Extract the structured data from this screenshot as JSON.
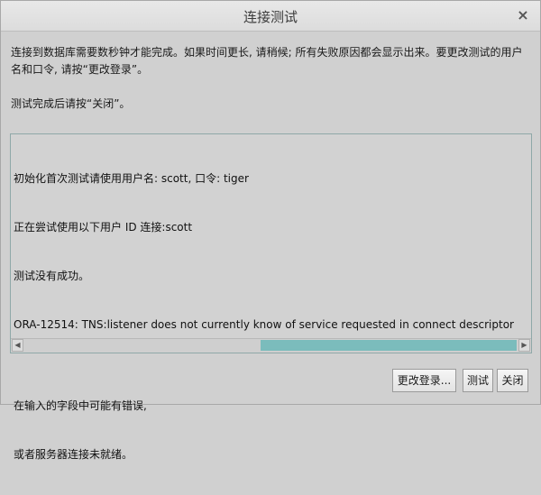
{
  "window": {
    "title": "连接测试",
    "close_glyph": "×"
  },
  "info": {
    "line1": "连接到数据库需要数秒钟才能完成。如果时间更长, 请稍候; 所有失败原因都会显示出来。要更改测试的用户",
    "line2": "名和口令, 请按“更改登录”。",
    "line3": "测试完成后请按“关闭”。"
  },
  "log": {
    "lines": [
      "初始化首次测试请使用用户名: scott, 口令: tiger",
      "正在尝试使用以下用户 ID 连接:scott",
      "测试没有成功。",
      "ORA-12514: TNS:listener does not currently know of service requested in connect descriptor",
      "",
      "在输入的字段中可能有错误,",
      "或者服务器连接未就绪。"
    ]
  },
  "scrollbar": {
    "left_arrow": "◀",
    "right_arrow": "▶"
  },
  "buttons": {
    "change_login": "更改登录...",
    "test": "测试",
    "close": "关闭"
  }
}
